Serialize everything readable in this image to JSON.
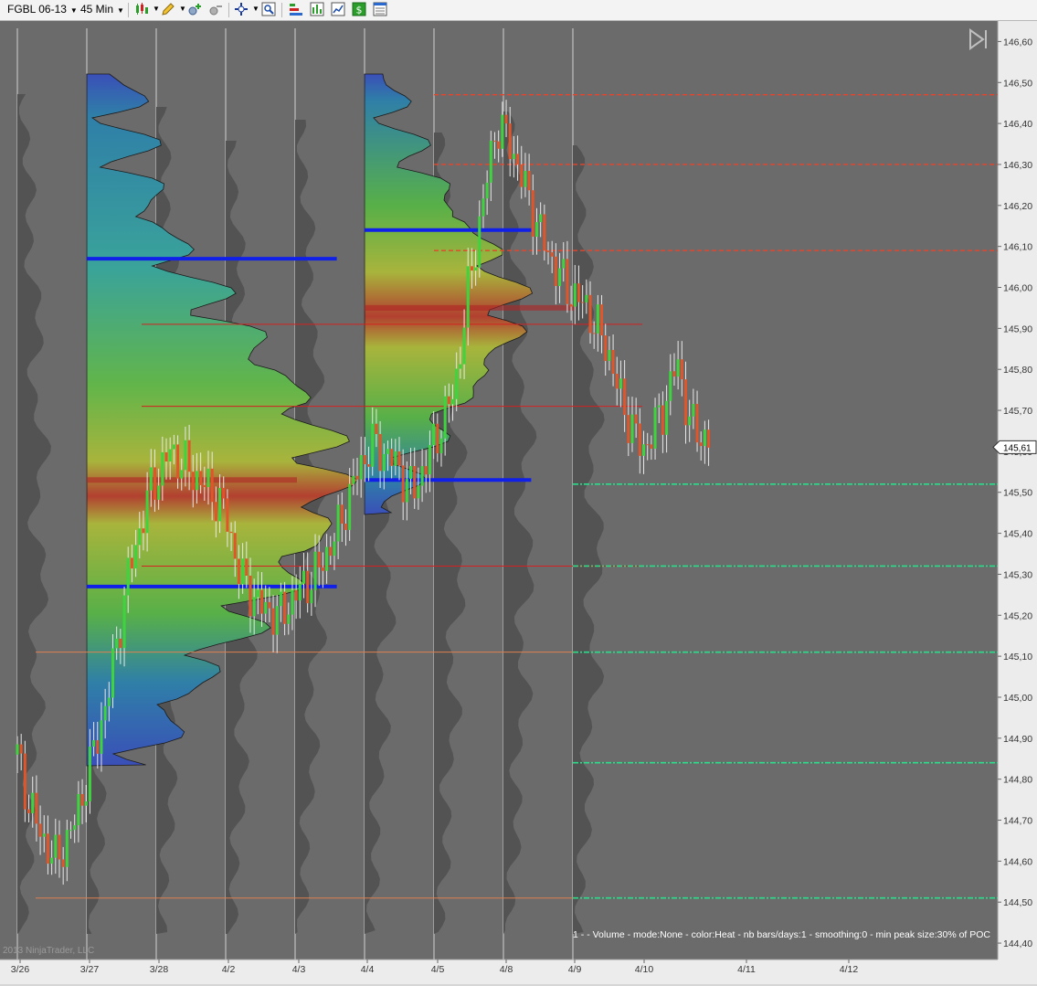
{
  "toolbar": {
    "instrument": "FGBL 06-13",
    "interval": "45 Min",
    "icons": [
      "candlestick-style-icon",
      "draw-pencil-icon",
      "zoom-in-icon",
      "zoom-out-icon",
      "crosshair-icon",
      "zoom-window-icon",
      "chart-properties-icon",
      "bar-chart-icon",
      "line-chart-icon",
      "dollar-order-icon",
      "data-box-icon"
    ]
  },
  "colors": {
    "background": "#6b6b6b",
    "up_bar": "#3fd43f",
    "down_bar": "#e0552a",
    "poc_line": "#d42020",
    "value_area": "#1020e8",
    "future_level": "#26e08a",
    "resistance": "#e8442a"
  },
  "chart_data": {
    "type": "candlestick",
    "title": "",
    "y_ticks": [
      "146,60",
      "146,50",
      "146,40",
      "146,30",
      "146,20",
      "146,10",
      "146,00",
      "145,90",
      "145,80",
      "145,70",
      "145,60",
      "145,50",
      "145,40",
      "145,30",
      "145,20",
      "145,10",
      "145,00",
      "144,90",
      "144,80",
      "144,70",
      "144,60",
      "144,50",
      "144,40"
    ],
    "ylim": [
      144.36,
      146.65
    ],
    "x_ticks": [
      "3/26",
      "3/27",
      "3/28",
      "4/2",
      "4/3",
      "4/4",
      "4/5",
      "4/8",
      "4/9",
      "4/10",
      "4/11",
      "4/12"
    ],
    "last_price": "145,61",
    "last_price_value": 145.61,
    "grid": true,
    "volume_profiles": [
      {
        "session": "3/27-4/3",
        "poc": 145.53,
        "value_area_high": 146.07,
        "value_area_low": 145.27
      },
      {
        "session": "4/4-4/8",
        "poc": 145.95,
        "value_area_high": 146.14,
        "value_area_low": 145.53
      }
    ],
    "levels": {
      "poc_lines": [
        145.91,
        145.71,
        145.32
      ],
      "resistance_lines": [
        146.47,
        146.3,
        146.09
      ],
      "low_lines": [
        145.11,
        144.51
      ],
      "future_levels": [
        145.52,
        145.32,
        145.11,
        144.84,
        144.51
      ]
    },
    "price_path": [
      [
        0,
        144.86
      ],
      [
        0.15,
        144.75
      ],
      [
        0.35,
        144.66
      ],
      [
        0.55,
        144.6
      ],
      [
        0.8,
        144.68
      ],
      [
        1,
        144.8
      ],
      [
        1.3,
        145.0
      ],
      [
        1.6,
        145.3
      ],
      [
        1.9,
        145.5
      ],
      [
        2.2,
        145.6
      ],
      [
        2.5,
        145.55
      ],
      [
        2.8,
        145.5
      ],
      [
        3,
        145.45
      ],
      [
        3.2,
        145.3
      ],
      [
        3.5,
        145.22
      ],
      [
        3.8,
        145.2
      ],
      [
        4,
        145.25
      ],
      [
        4.3,
        145.3
      ],
      [
        4.6,
        145.4
      ],
      [
        4.9,
        145.55
      ],
      [
        5.1,
        145.62
      ],
      [
        5.4,
        145.58
      ],
      [
        5.7,
        145.5
      ],
      [
        6,
        145.62
      ],
      [
        6.3,
        145.75
      ],
      [
        6.5,
        146.0
      ],
      [
        6.7,
        146.2
      ],
      [
        6.9,
        146.4
      ],
      [
        7.1,
        146.35
      ],
      [
        7.3,
        146.25
      ],
      [
        7.6,
        146.1
      ],
      [
        7.9,
        146.0
      ],
      [
        8.2,
        145.95
      ],
      [
        8.5,
        145.85
      ],
      [
        8.7,
        145.72
      ],
      [
        9,
        145.6
      ],
      [
        9.3,
        145.7
      ],
      [
        9.5,
        145.82
      ],
      [
        9.7,
        145.66
      ],
      [
        10,
        145.62
      ]
    ],
    "indicator_label": "1 -  - Volume - mode:None - color:Heat - nb bars/days:1 - smoothing:0 - min peak size:30% of POC",
    "copyright": "2013 NinjaTrader, LLC"
  }
}
